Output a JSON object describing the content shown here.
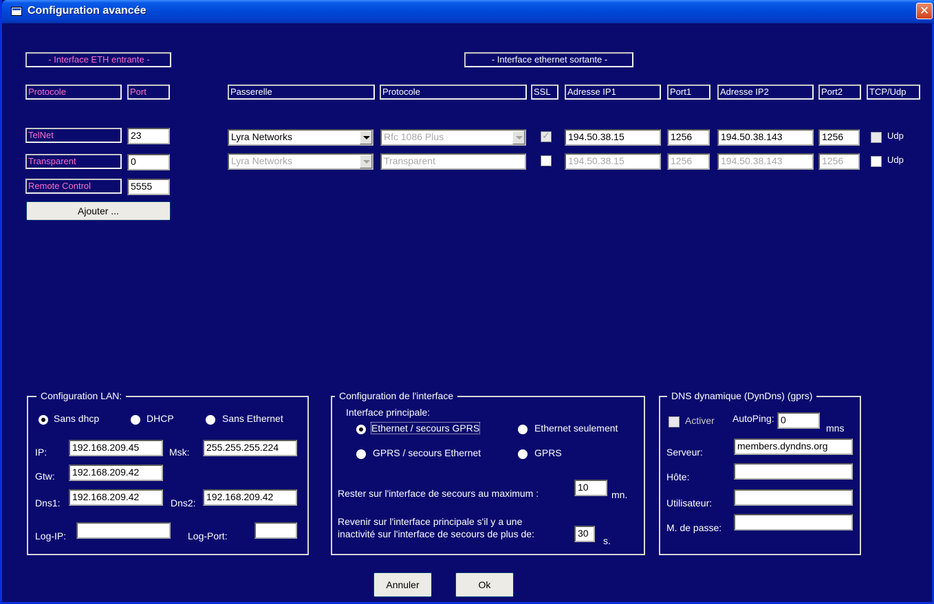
{
  "window": {
    "title": "Configuration avancée",
    "close_icon": "close-icon"
  },
  "incoming": {
    "group_label": "- Interface ETH entrante -",
    "col_protocol": "Protocole",
    "col_port": "Port",
    "rows": [
      {
        "protocol": "TelNet",
        "port": "23"
      },
      {
        "protocol": "Transparent",
        "port": "0"
      },
      {
        "protocol": "Remote Control",
        "port": "5555"
      }
    ],
    "add_button": "Ajouter ..."
  },
  "outgoing": {
    "group_label": "-  Interface ethernet sortante  -",
    "headers": {
      "gateway": "Passerelle",
      "protocol": "Protocole",
      "ssl": "SSL",
      "ip1": "Adresse  IP1",
      "port1": "Port1",
      "ip2": "Adresse IP2",
      "port2": "Port2",
      "tcp_udp": "TCP/Udp"
    },
    "rows": [
      {
        "gateway": "Lyra Networks",
        "protocol": "Rfc 1086 Plus",
        "ip1": "194.50.38.15",
        "port1": "1256",
        "ip2": "194.50.38.143",
        "port2": "1256",
        "udp_label": "Udp"
      },
      {
        "gateway": "Lyra Networks",
        "protocol": "Transparent",
        "ip1": "194.50.38.15",
        "port1": "1256",
        "ip2": "194.50.38.143",
        "port2": "1256",
        "udp_label": "Udp"
      }
    ]
  },
  "lan": {
    "legend": "Configuration LAN:",
    "options": [
      "Sans dhcp",
      "DHCP",
      "Sans Ethernet"
    ],
    "ip_label": "IP:",
    "ip": "192.168.209.45",
    "msk_label": "Msk:",
    "msk": "255.255.255.224",
    "gtw_label": "Gtw:",
    "gtw": "192.168.209.42",
    "dns1_label": "Dns1:",
    "dns1": "192.168.209.42",
    "dns2_label": "Dns2:",
    "dns2": "192.168.209.42",
    "logip_label": "Log-IP:",
    "logip": "",
    "logport_label": "Log-Port:",
    "logport": ""
  },
  "iface": {
    "legend": "Configuration de l'interface",
    "main_label": "Interface principale:",
    "options": [
      "Ethernet / secours GPRS",
      "Ethernet seulement",
      "GPRS / secours Ethernet",
      "GPRS"
    ],
    "stay_text": "Rester sur l'interface de secours au maximum :",
    "stay_value": "10",
    "stay_unit": "mn.",
    "return_text_1": "Revenir sur l'interface principale s'il y a une",
    "return_text_2": "inactivité sur l'interface de secours de plus de:",
    "return_value": "30",
    "return_unit": "s."
  },
  "dyndns": {
    "legend": "DNS dynamique  (DynDns)  (gprs)",
    "activate_label": "Activer",
    "autoping_label": "AutoPing:",
    "autoping": "0",
    "autoping_unit": "mns",
    "server_label": "Serveur:",
    "server": "members.dyndns.org",
    "host_label": "Hôte:",
    "host": "",
    "user_label": "Utilisateur:",
    "user": "",
    "pass_label": "M. de passe:",
    "pass": ""
  },
  "footer": {
    "cancel": "Annuler",
    "ok": "Ok"
  }
}
